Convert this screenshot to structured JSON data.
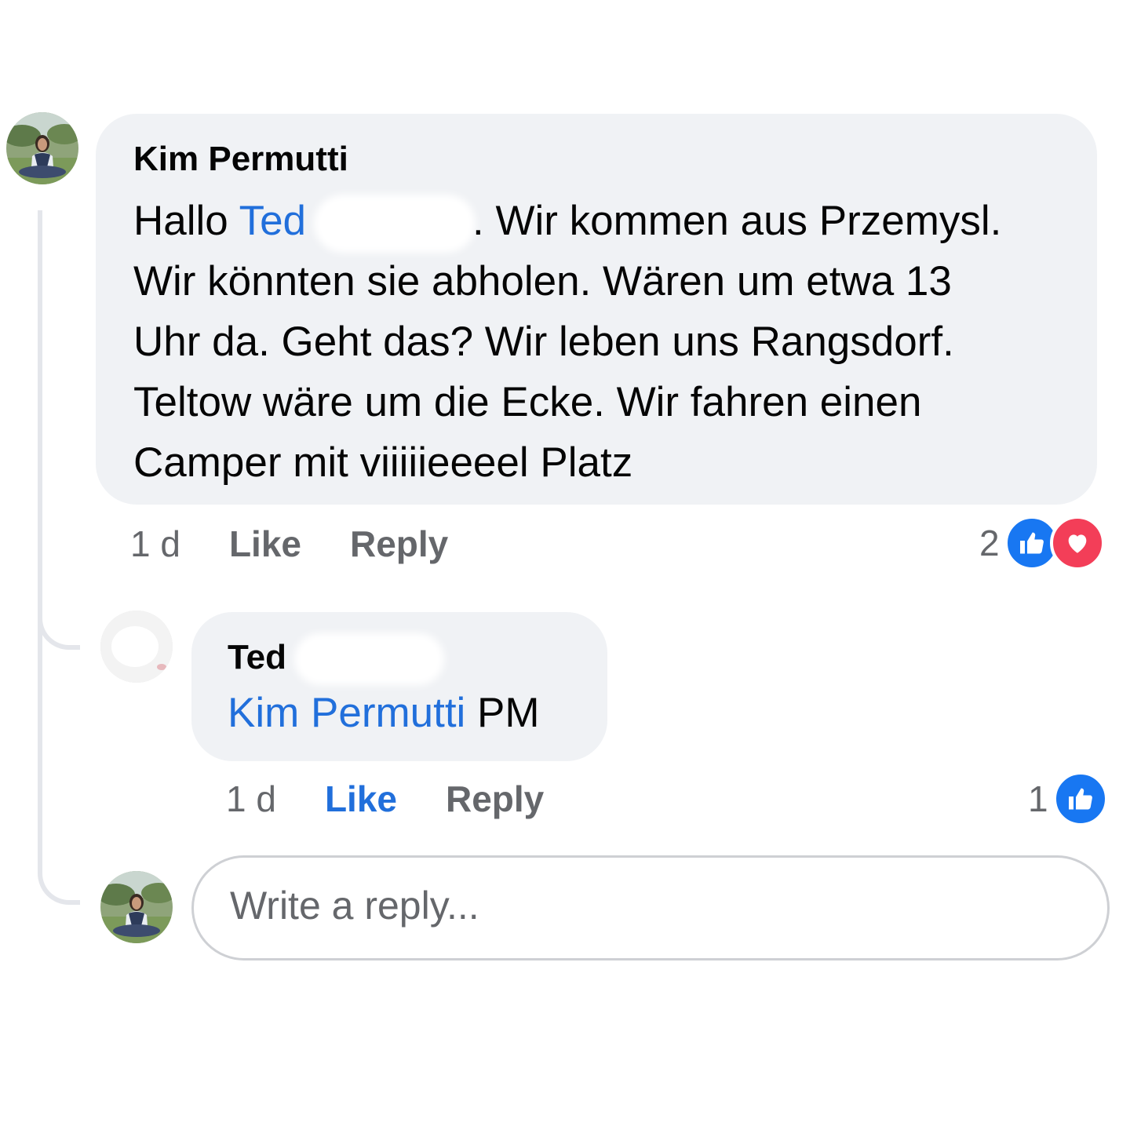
{
  "comment": {
    "author": "Kim Permutti",
    "greeting": "Hallo",
    "mention": "Ted",
    "lines": {
      "line1_rest": ". Wir kommen aus Przemysl.",
      "line2": "Wir könnten sie abholen. Wären um etwa 13",
      "line3": "Uhr da. Geht das? Wir leben uns Rangsdorf.",
      "line4": "Teltow wäre um die Ecke. Wir fahren einen",
      "line5": "Camper mit viiiiieeeel Platz"
    },
    "time": "1 d",
    "like_label": "Like",
    "reply_label": "Reply",
    "reaction_count": "2",
    "reactions": [
      "like-icon",
      "love-icon"
    ]
  },
  "reply": {
    "author": "Ted",
    "mention": "Kim Permutti",
    "text": " PM",
    "time": "1 d",
    "like_label": "Like",
    "reply_label": "Reply",
    "liked_by_viewer": true,
    "reaction_count": "1",
    "reactions": [
      "like-icon"
    ]
  },
  "composer": {
    "placeholder": "Write a reply..."
  },
  "colors": {
    "accent": "#216fdb",
    "bubble": "#f0f2f5",
    "meta": "#65676b",
    "like": "#1877f2",
    "love": "#f33e58"
  }
}
